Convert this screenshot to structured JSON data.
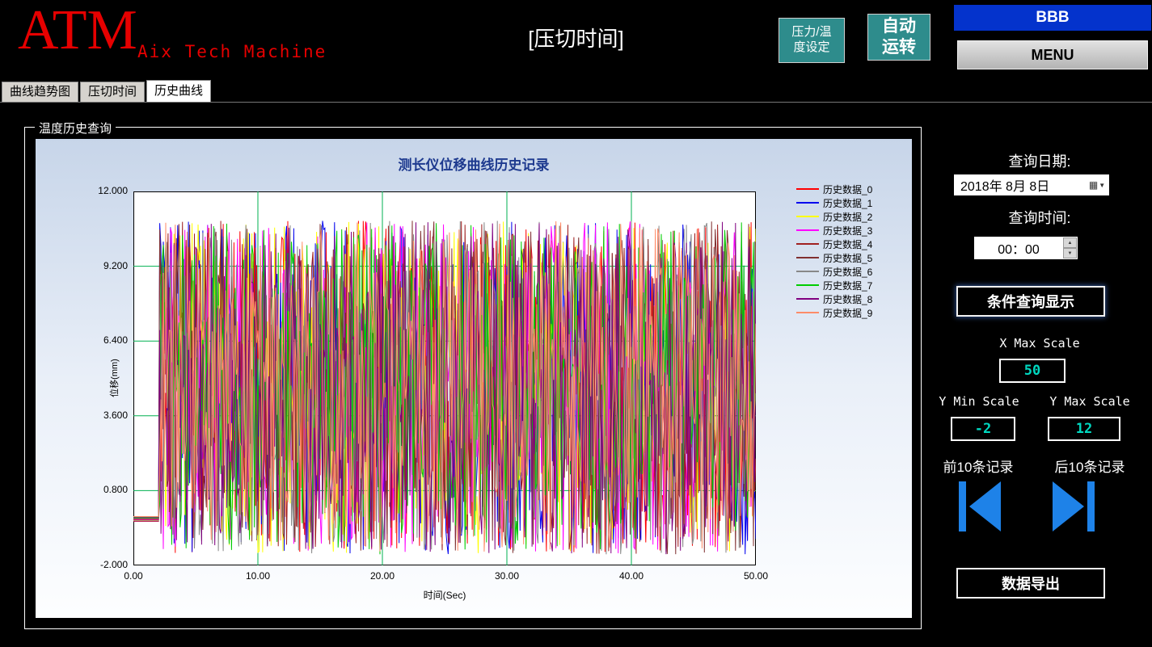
{
  "colors": {
    "logo_red": "#e60000",
    "button_teal": "#2e8c8c",
    "banner_blue": "#0433cc",
    "title_navy": "#1e3a8f",
    "value_teal": "#00d8c0",
    "arrow_blue": "#1e82e8"
  },
  "header": {
    "logo": "ATM",
    "logo_sub": "Aix Tech Machine",
    "title": "[压切时间]",
    "pressure_temp_btn_line1": "压力/温",
    "pressure_temp_btn_line2": "度设定",
    "auto_btn_line1": "自动",
    "auto_btn_line2": "运转",
    "bbb": "BBB",
    "menu": "MENU"
  },
  "tabs": [
    "曲线趋势图",
    "压切时间",
    "历史曲线"
  ],
  "active_tab": 2,
  "groupbox": {
    "title": "温度历史查询"
  },
  "chart_data": {
    "type": "line",
    "title": "测长仪位移曲线历史记录",
    "xlabel": "时间(Sec)",
    "ylabel": "位移(mm)",
    "xlim": [
      0,
      50
    ],
    "ylim": [
      -2,
      12
    ],
    "x_ticks": [
      "0.00",
      "10.00",
      "20.00",
      "30.00",
      "40.00",
      "50.00"
    ],
    "y_ticks": [
      "12.000",
      "9.200",
      "6.400",
      "3.600",
      "0.800",
      "-2.000"
    ],
    "grid": true,
    "grid_color": "#00b050",
    "legend_position": "right",
    "series": [
      {
        "name": "历史数据_0",
        "color": "#ff0000"
      },
      {
        "name": "历史数据_1",
        "color": "#0000ee"
      },
      {
        "name": "历史数据_2",
        "color": "#ffff00"
      },
      {
        "name": "历史数据_3",
        "color": "#ff00ff"
      },
      {
        "name": "历史数据_4",
        "color": "#a02020"
      },
      {
        "name": "历史数据_5",
        "color": "#803030"
      },
      {
        "name": "历史数据_6",
        "color": "#888888"
      },
      {
        "name": "历史数据_7",
        "color": "#00cc00"
      },
      {
        "name": "历史数据_8",
        "color": "#800080"
      },
      {
        "name": "历史数据_9",
        "color": "#ff8c69"
      }
    ],
    "pattern": {
      "description": "each series flat near 0 until ~2s, then dense random noise spanning roughly -1.6 to 10.9 mm until 50s",
      "flat_until_x": 2.1,
      "flat_value": -0.35,
      "noise_min": -1.6,
      "noise_max": 10.9,
      "points_per_series": 520
    }
  },
  "right_panel": {
    "query_date_label": "查询日期:",
    "date_value": "2018年 8月 8日",
    "query_time_label": "查询时间:",
    "time_value": "00：00",
    "query_button_label": "条件查询显示",
    "x_max_label": "X Max Scale",
    "x_max_value": "50",
    "y_min_label": "Y Min Scale",
    "y_min_value": "-2",
    "y_max_label": "Y Max Scale",
    "y_max_value": "12",
    "prev_records_label": "前10条记录",
    "next_records_label": "后10条记录",
    "export_button_label": "数据导出"
  }
}
